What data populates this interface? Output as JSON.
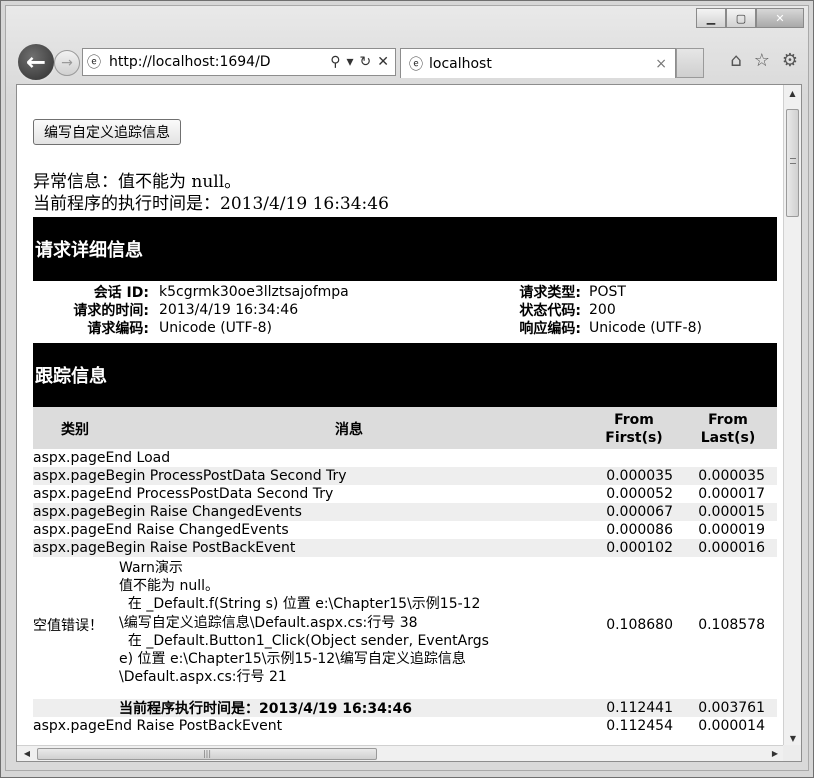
{
  "browser": {
    "url": "http://localhost:1694/D",
    "tab_title": "localhost"
  },
  "page": {
    "trace_button": "编写自定义追踪信息",
    "error_line": "异常信息：值不能为 null。",
    "time_line": "当前程序的执行时间是：2013/4/19 16:34:46",
    "request_header": "请求详细信息",
    "trace_header": "跟踪信息"
  },
  "request_details": [
    {
      "label": "会话 ID:",
      "value": "k5cgrmk30oe3llztsajofmpa",
      "label2": "请求类型:",
      "value2": "POST"
    },
    {
      "label": "请求的时间:",
      "value": "2013/4/19 16:34:46",
      "label2": "状态代码:",
      "value2": "200"
    },
    {
      "label": "请求编码:",
      "value": "Unicode (UTF-8)",
      "label2": "响应编码:",
      "value2": "Unicode (UTF-8)"
    }
  ],
  "trace_columns": {
    "category": "类别",
    "message": "消息",
    "from_first": "From First(s)",
    "from_last": "From Last(s)"
  },
  "trace_rows": [
    {
      "category": "aspx.pageEnd Load",
      "first": "",
      "last": ""
    },
    {
      "category": "aspx.pageBegin ProcessPostData Second Try",
      "first": "0.000035",
      "last": "0.000035"
    },
    {
      "category": "aspx.pageEnd ProcessPostData Second Try",
      "first": "0.000052",
      "last": "0.000017"
    },
    {
      "category": "aspx.pageBegin Raise ChangedEvents",
      "first": "0.000067",
      "last": "0.000015"
    },
    {
      "category": "aspx.pageEnd Raise ChangedEvents",
      "first": "0.000086",
      "last": "0.000019"
    },
    {
      "category": "aspx.pageBegin Raise PostBackEvent",
      "first": "0.000102",
      "last": "0.000016"
    }
  ],
  "warn_row": {
    "category": "空值错误！",
    "lines": [
      "Warn演示",
      "值不能为 null。",
      "  在 _Default.f(String s) 位置 e:\\Chapter15\\示例15-12",
      "\\编写自定义追踪信息\\Default.aspx.cs:行号 38",
      "  在 _Default.Button1_Click(Object sender, EventArgs",
      "e) 位置 e:\\Chapter15\\示例15-12\\编写自定义追踪信息",
      "\\Default.aspx.cs:行号 21"
    ],
    "first": "0.108680",
    "last": "0.108578"
  },
  "time_row": {
    "message": "当前程序执行时间是：2013/4/19 16:34:46",
    "first": "0.112441",
    "last": "0.003761"
  },
  "last_row": {
    "category": "aspx.pageEnd Raise PostBackEvent",
    "first": "0.112454",
    "last": "0.000014"
  }
}
